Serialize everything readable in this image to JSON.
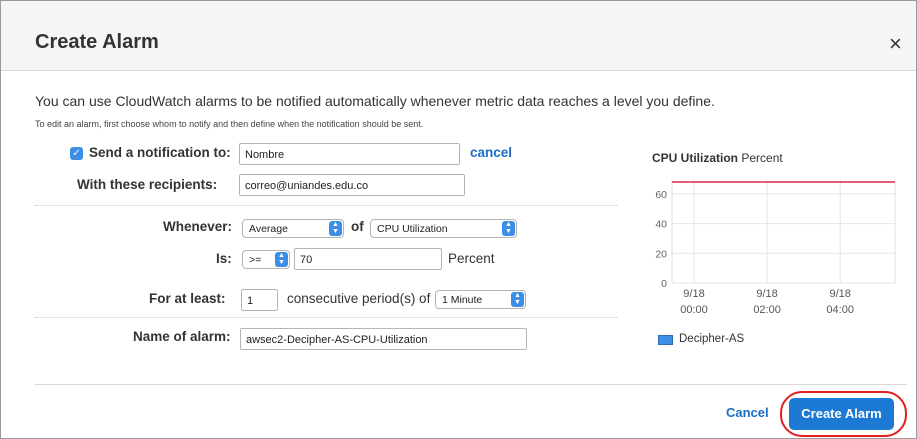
{
  "dialog": {
    "title": "Create Alarm",
    "close_glyph": "×",
    "close_icon": "close-icon"
  },
  "intro": {
    "text": "You can use CloudWatch alarms to be notified automatically whenever metric data reaches a level you define.",
    "subtext": "To edit an alarm, first choose whom to notify and then define when the notification should be sent."
  },
  "notification": {
    "checked": true,
    "checkbox_glyph": "✓",
    "label": "Send a notification to:",
    "value": "Nombre",
    "cancel_label": "cancel",
    "recipients_label": "With these recipients:",
    "recipients_value": "correo@uniandes.edu.co"
  },
  "condition": {
    "whenever_label": "Whenever:",
    "statistic": "Average",
    "of_label": "of",
    "metric": "CPU Utilization",
    "is_label": "Is:",
    "operator": ">=",
    "threshold": "70",
    "unit": "Percent",
    "for_label": "For at least:",
    "periods": "1",
    "periods_text": "consecutive period(s) of",
    "period_length": "1 Minute"
  },
  "name": {
    "label": "Name of alarm:",
    "value": "awsec2-Decipher-AS-CPU-Utilization"
  },
  "chart_data": {
    "type": "line",
    "title": "CPU Utilization",
    "title_unit": "Percent",
    "y_ticks": [
      "60",
      "40",
      "20",
      "0"
    ],
    "ylim": [
      0,
      70
    ],
    "x_ticks": [
      [
        "9/18",
        "00:00"
      ],
      [
        "9/18",
        "02:00"
      ],
      [
        "9/18",
        "04:00"
      ]
    ],
    "threshold": 70,
    "threshold_color": "#d0021b",
    "series": [
      {
        "name": "Decipher-AS",
        "color": "#3d8fe6",
        "values": []
      }
    ],
    "legend": "bottom-left",
    "grid": true
  },
  "footer": {
    "cancel_label": "Cancel",
    "create_label": "Create Alarm",
    "highlight_color": "#e02020"
  },
  "colors": {
    "accent": "#1c79d4",
    "link": "#1a6fc4"
  }
}
